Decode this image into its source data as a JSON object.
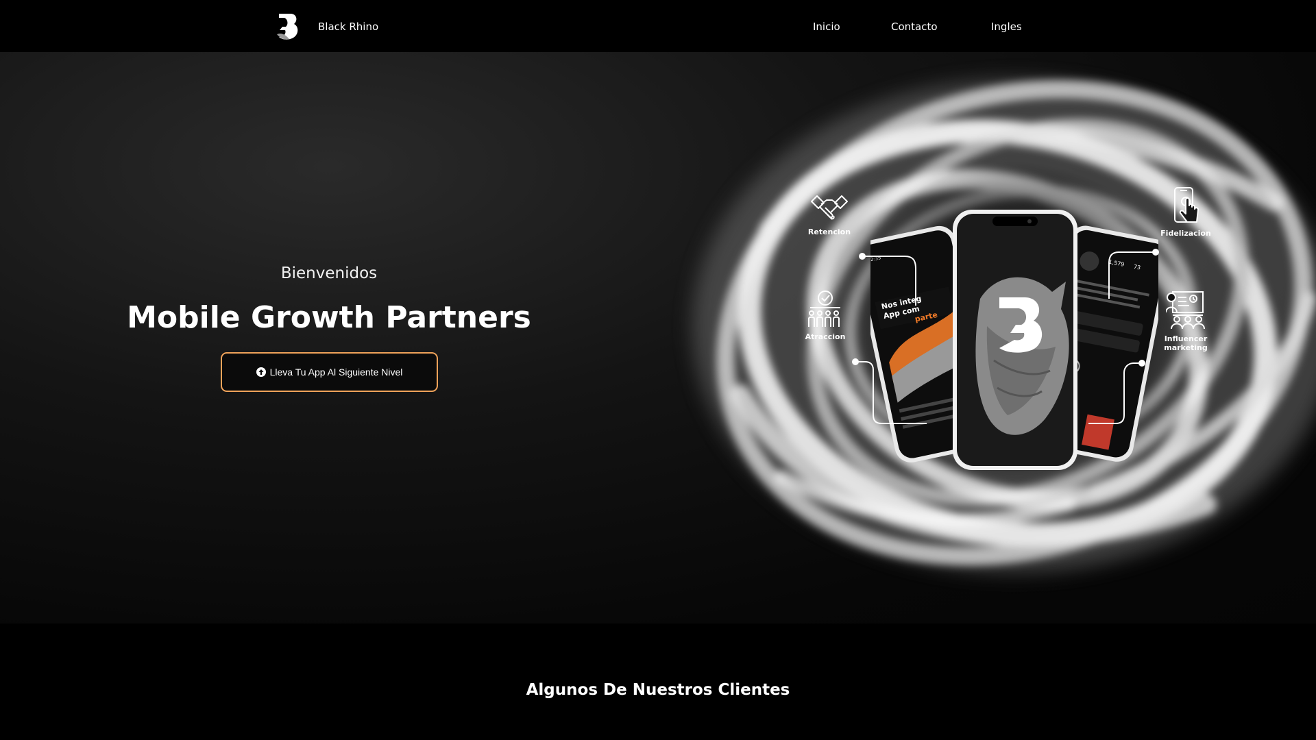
{
  "nav": {
    "brand_name": "Black Rhino",
    "links": [
      "Inicio",
      "Contacto",
      "Ingles"
    ]
  },
  "hero": {
    "welcome": "Bienvenidos",
    "headline_light": "Mobile ",
    "headline_bold": "Growth Partners",
    "cta_label": "Lleva Tu App Al Siguiente Nivel",
    "cta_icon": "arrow-up-circle-icon"
  },
  "features": {
    "retencion": "Retencion",
    "atraccion": "Atraccion",
    "fidelizacion": "Fidelizacion",
    "influencer_line1": "Influencer",
    "influencer_line2": "marketing"
  },
  "phones": {
    "left_screen_text": "Nos integ App com parte",
    "right_screen_stats": [
      "1,579",
      "73"
    ],
    "time": "12:35"
  },
  "clients": {
    "title_light": "Algunos De Nuestros ",
    "title_bold": "Clientes"
  },
  "colors": {
    "accent": "#f0a35a",
    "background": "#000000",
    "text": "#ffffff"
  }
}
